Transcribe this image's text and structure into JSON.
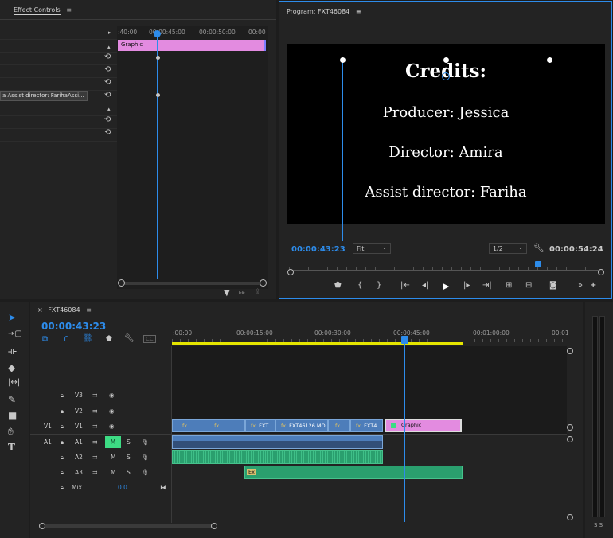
{
  "effect_controls": {
    "tab_label": "Effect Controls",
    "menu_glyph": "≡",
    "ruler_labels": [
      ":40:00",
      "00:00:45:00",
      "00:00:50:00",
      "00:00"
    ],
    "clip_label": "Graphic",
    "text_layer_label": "a Assist director: FarihaAssi..."
  },
  "program": {
    "tab_label": "Program: FXT46084",
    "menu_glyph": "≡",
    "credits": [
      "Credits:",
      "Producer: Jessica",
      "Director: Amira",
      "Assist director: Fariha"
    ],
    "current_time": "00:00:43:23",
    "fit": "Fit",
    "resolution": "1/2",
    "duration": "00:00:54:24"
  },
  "sequence": {
    "close_glyph": "×",
    "tab_label": "FXT46084",
    "menu_glyph": "≡",
    "timecode": "00:00:43:23",
    "ruler_labels": [
      ":00:00",
      "00:00:15:00",
      "00:00:30:00",
      "00:00:45:00",
      "00:01:00:00",
      "00:01"
    ],
    "tracks": {
      "v3": "V3",
      "v2": "V2",
      "v1_src": "V1",
      "v1": "V1",
      "a1_src": "A1",
      "a1": "A1",
      "a2": "A2",
      "a3": "A3",
      "mix": "Mix",
      "mix_value": "0.0",
      "m": "M",
      "s": "S"
    },
    "clips": {
      "fx": "fx",
      "fxt": "FXT",
      "mo": "FXT46126.MO",
      "fxt4": "FXT4",
      "graphic": "Graphic",
      "ex": "Ex"
    }
  },
  "meter": {
    "labels": "S S"
  },
  "colors": {
    "accent": "#2d8ceb",
    "graphic_clip": "#e38be0",
    "video_clip": "#4d7dba",
    "audio_clip": "#2a9f6e",
    "in_out_bar": "#e5e500"
  }
}
